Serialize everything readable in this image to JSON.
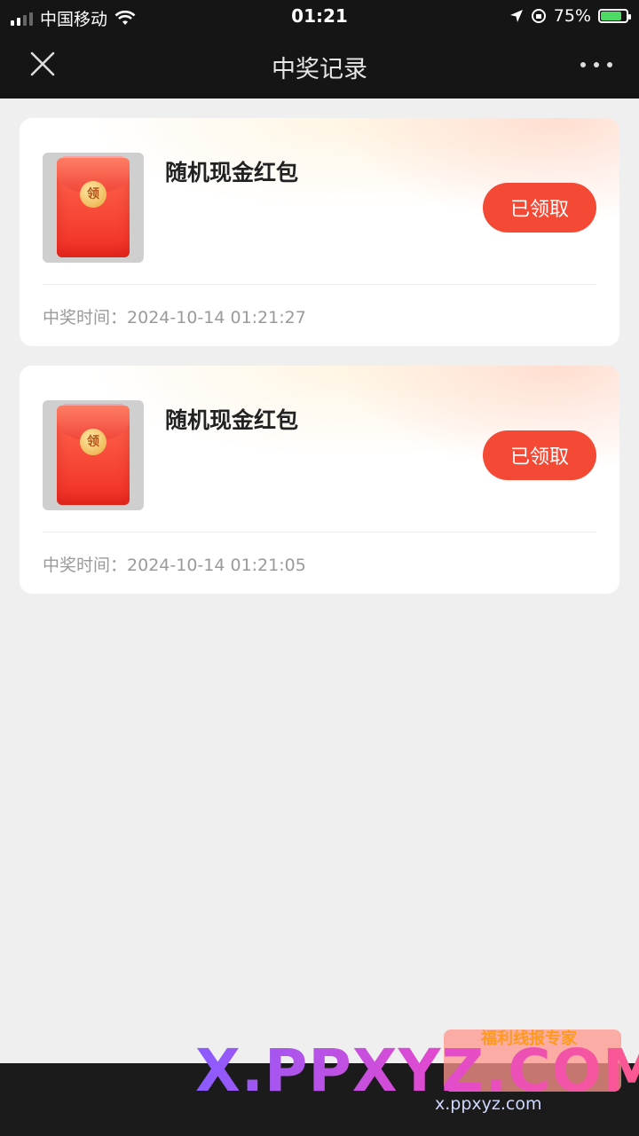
{
  "status_bar": {
    "carrier": "中国移动",
    "time": "01:21",
    "battery": "75%",
    "battery_level": 0.75
  },
  "nav": {
    "title": "中奖记录"
  },
  "records": [
    {
      "prize": "随机现金红包",
      "button": "已领取",
      "time_label": "中奖时间：",
      "time_value": "2024-10-14 01:21:27",
      "envelope_char": "领"
    },
    {
      "prize": "随机现金红包",
      "button": "已领取",
      "time_label": "中奖时间：",
      "time_value": "2024-10-14 01:21:05",
      "envelope_char": "领"
    }
  ],
  "watermark": {
    "logo_text": "X.PPXYZ.COM",
    "url": "x.ppxyz.com",
    "badge": "福利线报专家"
  },
  "colors": {
    "accent": "#f44a35",
    "nav_bg": "#151515",
    "page_bg": "#efefef"
  }
}
